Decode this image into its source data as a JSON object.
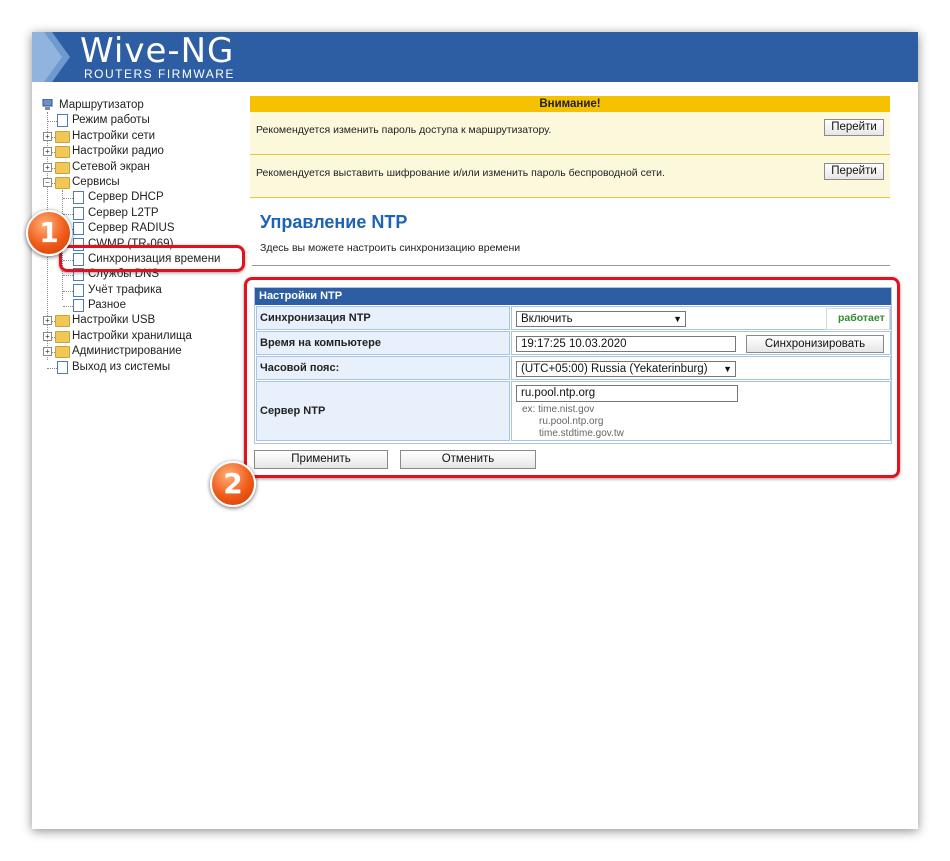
{
  "header": {
    "logo_title": "Wive-NG",
    "logo_subtitle": "ROUTERS FIRMWARE"
  },
  "sidebar": {
    "root": "Маршрутизатор",
    "items": [
      {
        "label": "Режим работы",
        "type": "doc",
        "level": 1
      },
      {
        "label": "Настройки сети",
        "type": "folder",
        "level": 1
      },
      {
        "label": "Настройки радио",
        "type": "folder",
        "level": 1
      },
      {
        "label": "Сетевой экран",
        "type": "folder",
        "level": 1
      },
      {
        "label": "Сервисы",
        "type": "folder-open",
        "level": 1
      },
      {
        "label": "Сервер DHCP",
        "type": "doc",
        "level": 2
      },
      {
        "label": "Сервер L2TP",
        "type": "doc",
        "level": 2
      },
      {
        "label": "Сервер RADIUS",
        "type": "doc",
        "level": 2
      },
      {
        "label": "CWMP (TR-069)",
        "type": "doc",
        "level": 2
      },
      {
        "label": "Синхронизация времени",
        "type": "doc",
        "level": 2,
        "selected": true
      },
      {
        "label": "Службы DNS",
        "type": "doc",
        "level": 2
      },
      {
        "label": "Учёт трафика",
        "type": "doc",
        "level": 2
      },
      {
        "label": "Разное",
        "type": "doc",
        "level": 2
      },
      {
        "label": "Настройки USB",
        "type": "folder",
        "level": 1
      },
      {
        "label": "Настройки хранилища",
        "type": "folder",
        "level": 1
      },
      {
        "label": "Администрирование",
        "type": "folder",
        "level": 1
      },
      {
        "label": "Выход из системы",
        "type": "doc",
        "level": 1
      }
    ]
  },
  "warning": {
    "title": "Внимание!",
    "messages": [
      {
        "text": "Рекомендуется изменить пароль доступа к маршрутизатору.",
        "button": "Перейти"
      },
      {
        "text": "Рекомендуется выставить шифрование и/или изменить пароль беспроводной сети.",
        "button": "Перейти"
      }
    ]
  },
  "page": {
    "title": "Управление NTP",
    "description": "Здесь вы можете настроить синхронизацию времени"
  },
  "ntp": {
    "header": "Настройки NTP",
    "sync_label": "Синхронизация NTP",
    "sync_value": "Включить",
    "sync_status": "работает",
    "time_label": "Время на компьютере",
    "time_value": "19:17:25 10.03.2020",
    "sync_button": "Синхронизировать",
    "tz_label": "Часовой пояс:",
    "tz_value": "(UTC+05:00) Russia (Yekaterinburg)",
    "server_label": "Сервер NTP",
    "server_value": "ru.pool.ntp.org",
    "server_hint_1": "ex: time.nist.gov",
    "server_hint_2": "ru.pool.ntp.org",
    "server_hint_3": "time.stdtime.gov.tw"
  },
  "actions": {
    "apply": "Применить",
    "cancel": "Отменить"
  },
  "annotations": {
    "badge_1": "1",
    "badge_2": "2"
  },
  "colors": {
    "header_blue": "#2d5ea3",
    "warning_yellow": "#f6c200",
    "highlight_red": "#e0121d",
    "badge_orange": "#ef5a17",
    "status_green": "#2e8b2e"
  }
}
